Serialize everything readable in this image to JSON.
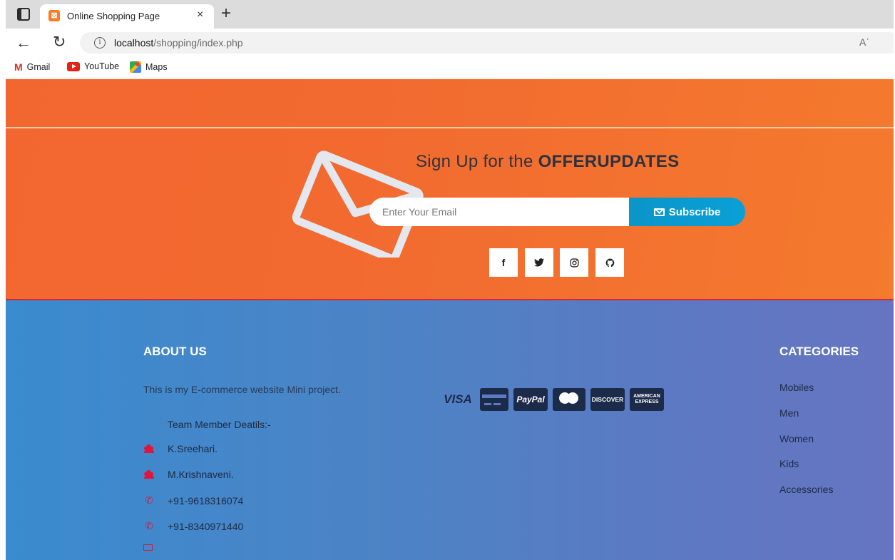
{
  "browser": {
    "tab_title": "Online Shopping Page",
    "tab_close": "×",
    "new_tab": "+",
    "url_host": "localhost",
    "url_path": "/shopping/index.php",
    "read_aloud": "Aʾ",
    "bookmarks": [
      "Gmail",
      "YouTube",
      "Maps"
    ]
  },
  "signup": {
    "title_prefix": "Sign Up for the ",
    "title_bold": "OFFERUPDATES",
    "email_placeholder": "Enter Your Email",
    "subscribe_label": "Subscribe",
    "social": {
      "facebook": "f",
      "twitter": "🐦",
      "instagram": "◎",
      "github": "○"
    }
  },
  "footer": {
    "about_title": "ABOUT US",
    "about_text": "This is my E-commerce website Mini project.",
    "team_title": "Team Member Deatils:-",
    "members": [
      "K.Sreehari.",
      "M.Krishnaveni."
    ],
    "phones": [
      "+91-9618316074",
      "+91-8340971440"
    ],
    "payments": {
      "visa": "VISA",
      "paypal": "PayPal",
      "discover": "DISCOVER",
      "amex": "AMERICAN EXPRESS"
    },
    "categories_title": "CATEGORIES",
    "categories": [
      "Mobiles",
      "Men",
      "Women",
      "Kids",
      "Accessories"
    ]
  },
  "colors": {
    "orange": "#f26a30",
    "subscribe": "#0b95c9",
    "footer_blue": "#4b84c6",
    "accent_red": "#e0143c"
  }
}
